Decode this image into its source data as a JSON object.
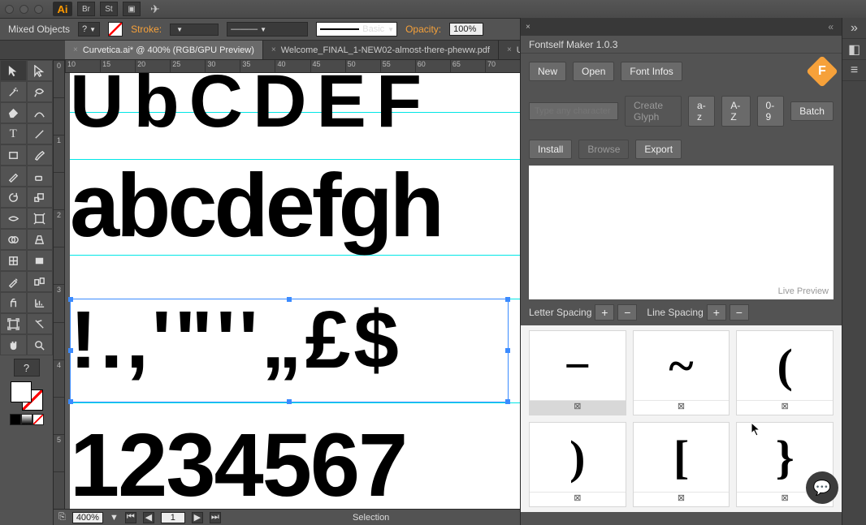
{
  "titlebar": {
    "app": "Ai"
  },
  "controlbar": {
    "selection": "Mixed Objects",
    "help": "?",
    "stroke_label": "Stroke:",
    "stroke_weight": "",
    "style_label": "Basic",
    "opacity_label": "Opacity:",
    "opacity_value": "100%"
  },
  "tabs": [
    {
      "label": "Curvetica.ai* @ 400% (RGB/GPU Preview)",
      "active": true
    },
    {
      "label": "Welcome_FINAL_1-NEW02-almost-there-pheww.pdf",
      "active": false
    },
    {
      "label": "U",
      "active": false
    }
  ],
  "hruler_marks": [
    "10",
    "15",
    "20",
    "25",
    "30",
    "35",
    "40",
    "45",
    "50",
    "55",
    "60",
    "65",
    "70"
  ],
  "vruler_marks": [
    "0",
    "",
    "1",
    "",
    "2",
    "",
    "3",
    "",
    "4",
    "",
    "5",
    ""
  ],
  "canvas": {
    "row_upper": "UbCDEF",
    "row_lower": "abcdefgh",
    "row_punct": "!.,'\"''„£$",
    "row_digits": "1234567"
  },
  "statusbar": {
    "zoom": "400%",
    "page": "1",
    "mode": "Selection"
  },
  "panel": {
    "title": "Fontself Maker 1.0.3",
    "btn_new": "New",
    "btn_open": "Open",
    "btn_infos": "Font Infos",
    "input_placeholder": "Type any character",
    "btn_create": "Create Glyph",
    "btn_az": "a-z",
    "btn_AZ": "A-Z",
    "btn_09": "0-9",
    "btn_batch": "Batch",
    "btn_install": "Install",
    "btn_browse": "Browse",
    "btn_export": "Export",
    "live_preview": "Live Preview",
    "letter_spacing": "Letter Spacing",
    "line_spacing": "Line Spacing",
    "cells": [
      {
        "glyph": "−",
        "label": "⊠",
        "hi": true
      },
      {
        "glyph": "~",
        "label": "⊠",
        "hi": false
      },
      {
        "glyph": "(",
        "label": "⊠",
        "hi": false
      },
      {
        "glyph": ")",
        "label": "⊠",
        "hi": false
      },
      {
        "glyph": "[",
        "label": "⊠",
        "hi": false
      },
      {
        "glyph": "}",
        "label": "⊠",
        "hi": false
      }
    ]
  }
}
